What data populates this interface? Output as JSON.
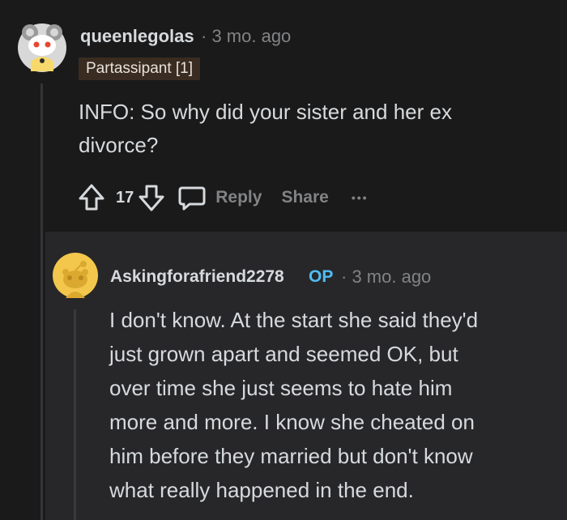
{
  "parent_comment": {
    "username": "queenlegolas",
    "separator": "·",
    "age": "3 mo. ago",
    "flair": "Partassipant [1]",
    "body_lines": [
      "INFO: So why did your sister and her ex",
      "divorce?"
    ],
    "votes": "17",
    "reply_label": "Reply",
    "share_label": "Share",
    "more_label": "•••"
  },
  "reply_comment": {
    "username": "Askingforafriend2278",
    "op_badge": "OP",
    "separator": "·",
    "age": "3 mo. ago",
    "body_lines": [
      "I don't know. At the start she said they'd",
      "just grown apart and seemed OK, but",
      "over time she just seems to hate him",
      "more and more. I know she cheated on",
      "him before they married but don't know",
      "what really happened in the end."
    ]
  },
  "colors": {
    "background": "#1a1a1b",
    "reply_background": "#272729",
    "text": "#d7dadc",
    "muted": "#818384",
    "op_badge": "#4fbdf4",
    "flair_bg": "#3b2c22"
  }
}
